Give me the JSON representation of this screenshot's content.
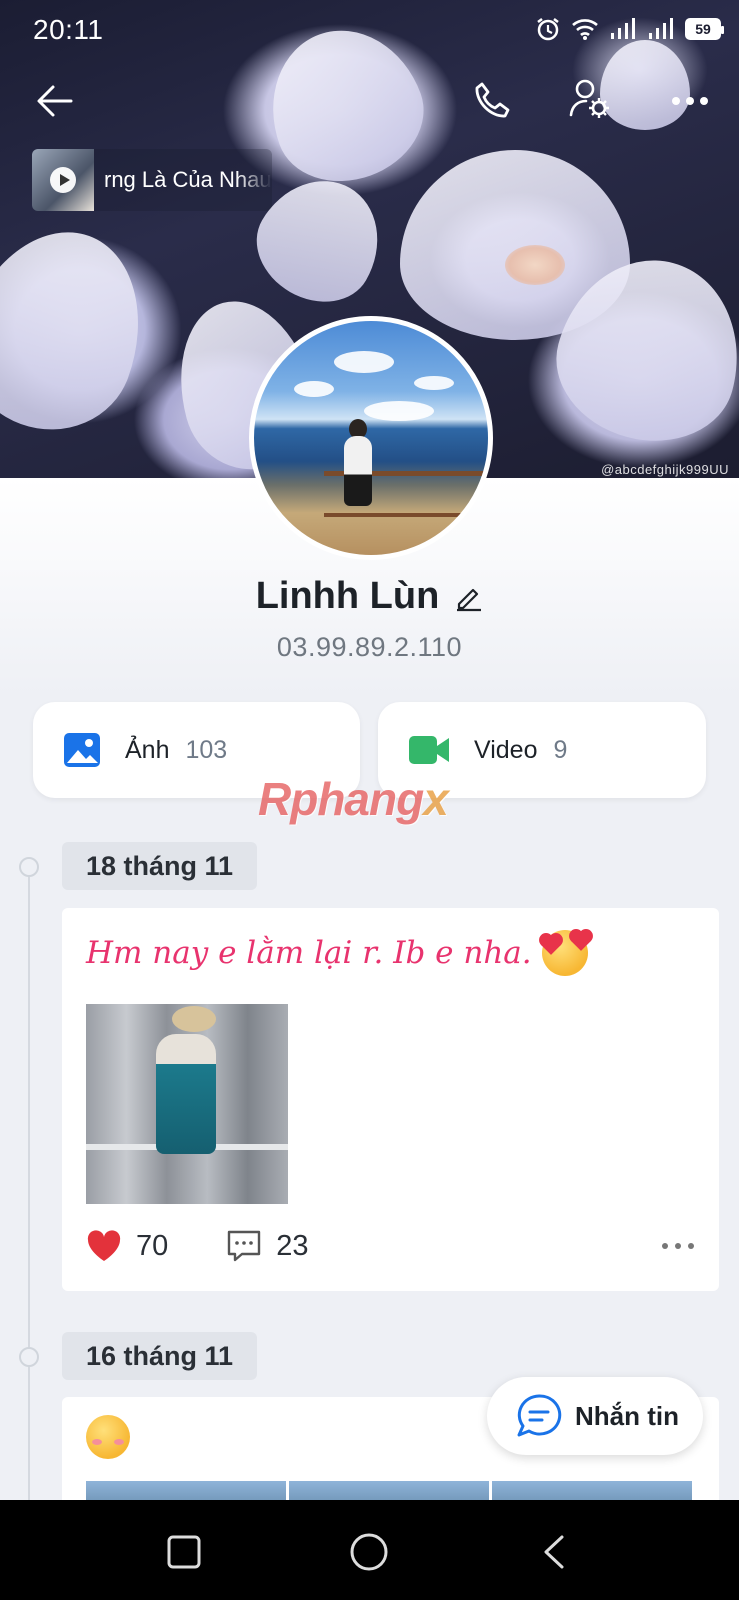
{
  "status_bar": {
    "time": "20:11",
    "battery": "59"
  },
  "header": {
    "music_title": "rng Là Của Nhau",
    "cover_watermark": "@abcdefghijk999UU"
  },
  "profile": {
    "name": "Linhh Lùn",
    "phone": "03.99.89.2.110"
  },
  "media": {
    "photos_label": "Ảnh",
    "photos_count": "103",
    "videos_label": "Video",
    "videos_count": "9"
  },
  "brand_watermark": {
    "main": "Rphang",
    "tail": "x"
  },
  "timeline": [
    {
      "date": "18 tháng 11",
      "text": "Hm nay e lằm lại r. Ib e nha.",
      "likes": "70",
      "comments": "23"
    },
    {
      "date": "16 tháng 11"
    }
  ],
  "message_button": {
    "label": "Nhắn tin"
  },
  "colors": {
    "accent_blue": "#1a73e8",
    "video_green": "#34b76a",
    "like_red": "#e3323b",
    "post_pink": "#e8336e"
  }
}
